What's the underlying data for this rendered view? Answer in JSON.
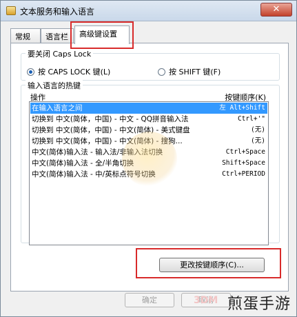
{
  "window": {
    "title": "文本服务和输入语言",
    "close_glyph": "✕"
  },
  "tabs": [
    {
      "label": "常规",
      "active": false
    },
    {
      "label": "语言栏",
      "active": false
    },
    {
      "label": "高级键设置",
      "active": true
    }
  ],
  "caps_lock": {
    "title": "要关闭 Caps Lock",
    "options": [
      {
        "label": "按 CAPS LOCK 键(L)",
        "selected": true
      },
      {
        "label": "按 SHIFT 键(F)",
        "selected": false
      }
    ]
  },
  "hotkeys": {
    "title": "输入语言的热键",
    "col_action": "操作",
    "col_sequence": "按键顺序(K)",
    "rows": [
      {
        "action": "在输入语言之间",
        "keys": "左 Alt+Shift",
        "selected": true
      },
      {
        "action": "切换到 中文(简体，中国) - 中文 - QQ拼音输入法",
        "keys": "Ctrl+'\"",
        "selected": false
      },
      {
        "action": "切换到 中文(简体，中国) - 中文(简体) - 美式键盘",
        "keys": "(无)",
        "selected": false
      },
      {
        "action": "切换到 中文(简体，中国) - 中文(简体) - 搜狗...",
        "keys": "(无)",
        "selected": false
      },
      {
        "action": "中文(简体)输入法 - 输入法/非输入法切换",
        "keys": "Ctrl+Space",
        "selected": false
      },
      {
        "action": "中文(简体)输入法 - 全/半角切换",
        "keys": "Shift+Space",
        "selected": false
      },
      {
        "action": "中文(简体)输入法 - 中/英标点符号切换",
        "keys": "Ctrl+PERIOD",
        "selected": false
      }
    ]
  },
  "buttons": {
    "change_sequence": "更改按键顺序(C)...",
    "ok": "确定",
    "cancel": "取消"
  },
  "watermark": {
    "text": "煎蛋手游",
    "faded": "3DM"
  },
  "colors": {
    "selection": "#3399ff",
    "highlight_box": "#d82a2a"
  }
}
